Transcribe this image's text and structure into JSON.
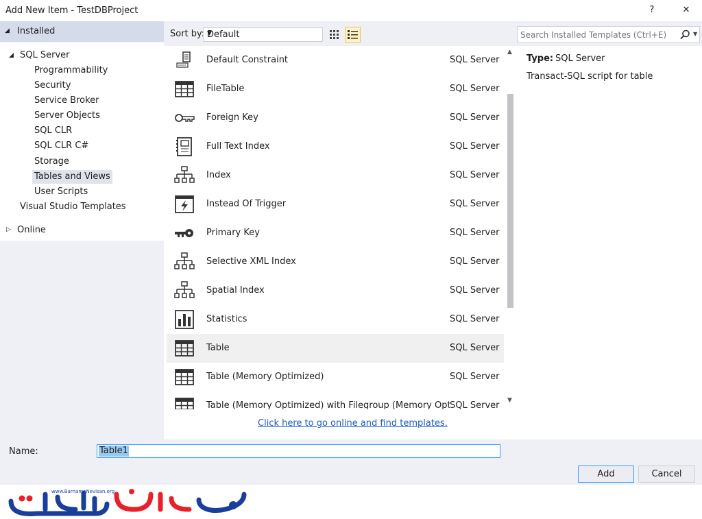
{
  "window": {
    "title": "Add New Item - TestDBProject",
    "help_label": "?",
    "close_label": "✕"
  },
  "tree": {
    "installed": "Installed",
    "sql_server": "SQL Server",
    "children": [
      "Programmability",
      "Security",
      "Service Broker",
      "Server Objects",
      "SQL CLR",
      "SQL CLR C#",
      "Storage",
      "Tables and Views",
      "User Scripts"
    ],
    "selected": "Tables and Views",
    "visual_studio_templates": "Visual Studio Templates",
    "online": "Online"
  },
  "toolbar": {
    "sort_label": "Sort by:",
    "sort_value": "Default",
    "search_placeholder": "Search Installed Templates (Ctrl+E)",
    "active_view": "list"
  },
  "templates": {
    "items": [
      {
        "name": "Default Constraint",
        "type": "SQL Server",
        "icon": "default-constraint-icon"
      },
      {
        "name": "FileTable",
        "type": "SQL Server",
        "icon": "table-icon"
      },
      {
        "name": "Foreign Key",
        "type": "SQL Server",
        "icon": "foreign-key-icon"
      },
      {
        "name": "Full Text Index",
        "type": "SQL Server",
        "icon": "full-text-index-icon"
      },
      {
        "name": "Index",
        "type": "SQL Server",
        "icon": "index-icon"
      },
      {
        "name": "Instead Of Trigger",
        "type": "SQL Server",
        "icon": "trigger-icon"
      },
      {
        "name": "Primary Key",
        "type": "SQL Server",
        "icon": "primary-key-icon"
      },
      {
        "name": "Selective XML Index",
        "type": "SQL Server",
        "icon": "index-icon"
      },
      {
        "name": "Spatial Index",
        "type": "SQL Server",
        "icon": "index-icon"
      },
      {
        "name": "Statistics",
        "type": "SQL Server",
        "icon": "statistics-icon"
      },
      {
        "name": "Table",
        "type": "SQL Server",
        "icon": "table-icon"
      },
      {
        "name": "Table (Memory Optimized)",
        "type": "SQL Server",
        "icon": "table-icon"
      },
      {
        "name": "Table (Memory Optimized) with Filegroup (Memory Optimi...",
        "type": "SQL Server",
        "icon": "table-icon"
      }
    ],
    "selected": "Table",
    "online_link": "Click here to go online and find templates."
  },
  "description": {
    "type_label": "Type:",
    "type_value": "SQL Server",
    "text": "Transact-SQL script for table"
  },
  "bottom": {
    "name_label": "Name:",
    "name_value": "Table1",
    "add_label": "Add",
    "cancel_label": "Cancel"
  },
  "logo": {
    "site_text": "www.BarnameNevisan.org",
    "brand_text": "برنامه نویسان"
  },
  "colors": {
    "accent_blue": "#3399ff",
    "link_blue": "#1b5bbf",
    "logo_red": "#e8202a",
    "logo_blue": "#1a3f9a"
  }
}
